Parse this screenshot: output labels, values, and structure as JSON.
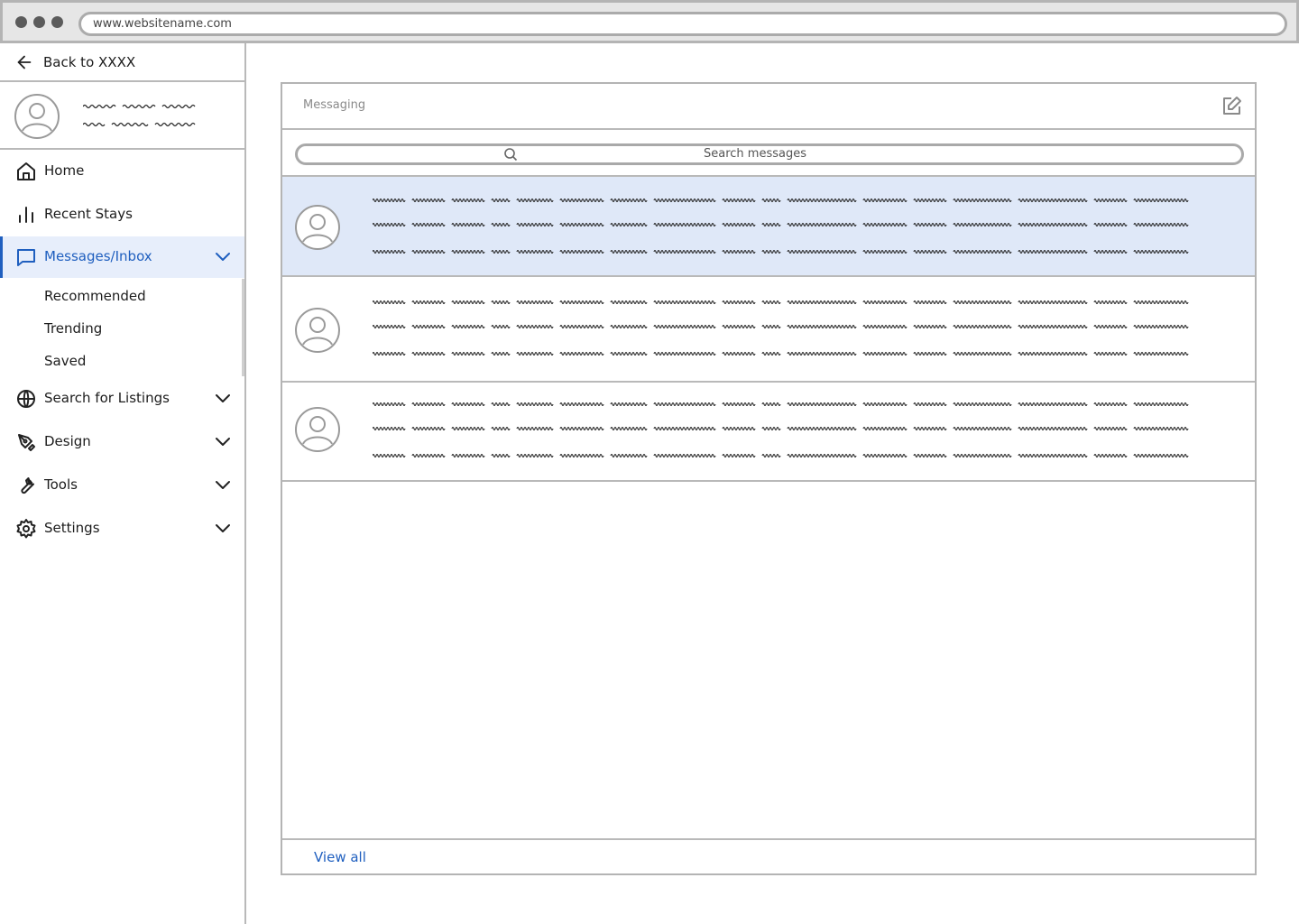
{
  "browser": {
    "url": "www.websitename.com"
  },
  "sidebar": {
    "back_label": "Back to XXXX",
    "nav": [
      {
        "label": "Home",
        "icon": "home-icon"
      },
      {
        "label": "Recent Stays",
        "icon": "bar-chart-icon"
      },
      {
        "label": "Messages/Inbox",
        "icon": "message-icon",
        "active": true,
        "expanded": true
      },
      {
        "label": "Search for Listings",
        "icon": "globe-icon"
      },
      {
        "label": "Design",
        "icon": "pen-tool-icon"
      },
      {
        "label": "Tools",
        "icon": "wrench-icon"
      },
      {
        "label": "Settings",
        "icon": "gear-icon"
      }
    ],
    "sub_items": [
      "Recommended",
      "Trending",
      "Saved"
    ]
  },
  "messaging": {
    "title": "Messaging",
    "search_placeholder": "Search messages",
    "threads_count": 3,
    "selected_thread": 1,
    "view_all": "View all"
  },
  "colors": {
    "accent": "#1f5fbf",
    "selected_bg": "#dfe8f8",
    "border": "#b9b9b9"
  }
}
